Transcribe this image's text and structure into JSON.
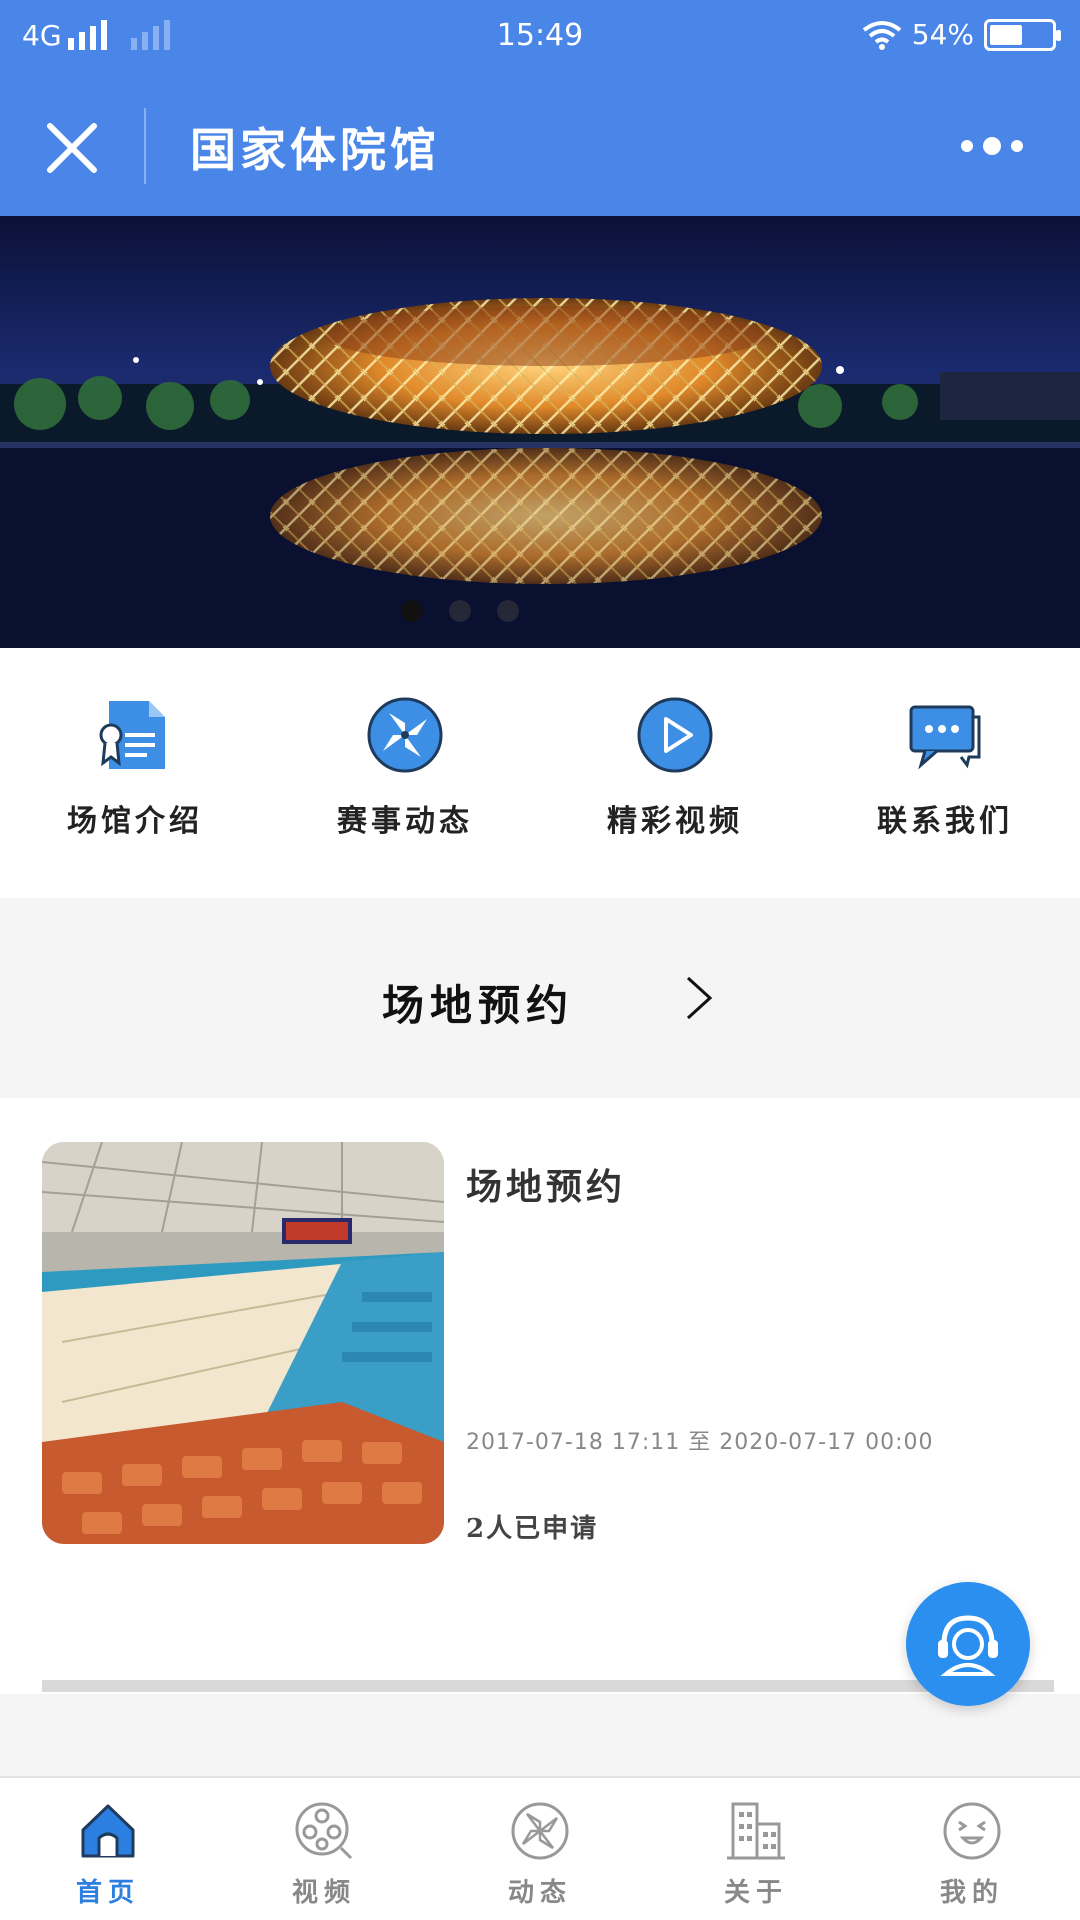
{
  "status_bar": {
    "network": "4G",
    "time": "15:49",
    "battery_text": "54%",
    "battery_level": 0.54
  },
  "header": {
    "title": "国家体院馆",
    "close_icon": "close-icon",
    "more_icon": "more-icon"
  },
  "banner": {
    "image": "stadium-night-photo",
    "slide_count": 3,
    "active_slide": 1
  },
  "quick_nav": [
    {
      "label": "场馆介绍",
      "icon": "document-icon"
    },
    {
      "label": "赛事动态",
      "icon": "pinwheel-icon"
    },
    {
      "label": "精彩视频",
      "icon": "play-icon"
    },
    {
      "label": "联系我们",
      "icon": "chat-icon"
    }
  ],
  "section": {
    "title": "场地预约",
    "arrow_icon": "chevron-right-icon"
  },
  "card": {
    "title": "场地预约",
    "date_range": "2017-07-18 17:11 至 2020-07-17 00:00",
    "applicants": "2人已申请",
    "image": "gymnasium-photo"
  },
  "fab": {
    "icon": "customer-service-icon"
  },
  "tabs": [
    {
      "label": "首页",
      "icon": "home-icon",
      "active": true
    },
    {
      "label": "视频",
      "icon": "film-reel-icon",
      "active": false
    },
    {
      "label": "动态",
      "icon": "pinwheel-icon",
      "active": false
    },
    {
      "label": "关于",
      "icon": "building-icon",
      "active": false
    },
    {
      "label": "我的",
      "icon": "smiley-icon",
      "active": false
    }
  ],
  "colors": {
    "primary": "#4a86e8",
    "accent": "#2b8ff0",
    "tab_active": "#2b7fe0"
  }
}
